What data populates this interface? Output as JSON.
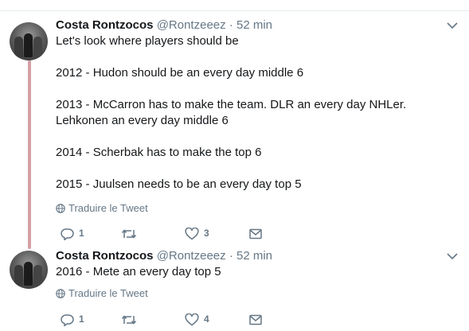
{
  "tweets": [
    {
      "author": {
        "name": "Costa Rontzocos",
        "handle": "@Rontzeeez",
        "separator": "·",
        "time": "52 min"
      },
      "lines": [
        "Let's look where players should be",
        "",
        "2012 - Hudon should be an every day middle 6",
        "",
        "2013 - McCarron has to make the team. DLR an every day NHLer. Lehkonen an every day middle 6",
        "",
        "2014 - Scherbak has to make the top 6",
        "",
        "2015 - Juulsen needs to be an every day top 5"
      ],
      "translate_label": "Traduire le Tweet",
      "actions": {
        "reply_count": "1",
        "retweet_count": "",
        "like_count": "3"
      }
    },
    {
      "author": {
        "name": "Costa Rontzocos",
        "handle": "@Rontzeeez",
        "separator": "·",
        "time": "52 min"
      },
      "lines": [
        "2016 - Mete an every day top 5"
      ],
      "translate_label": "Traduire le Tweet",
      "actions": {
        "reply_count": "1",
        "retweet_count": "",
        "like_count": "4"
      }
    }
  ],
  "icons": {
    "chevron": "chevron-down-icon",
    "globe": "globe-icon",
    "reply": "reply-icon",
    "retweet": "retweet-icon",
    "like": "heart-icon",
    "message": "envelope-icon"
  },
  "colors": {
    "thread_line": "#d6a0a6",
    "secondary_text": "#657786",
    "primary_text": "#14171a"
  }
}
